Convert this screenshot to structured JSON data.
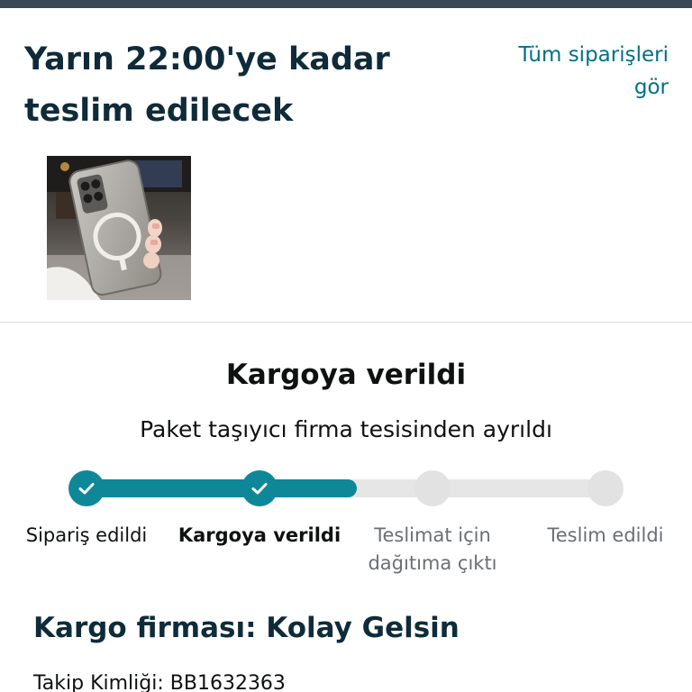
{
  "delivery": {
    "title_line1": "Yarın 22:00'ye kadar",
    "title_line2": "teslim edilecek",
    "all_orders_line1": "Tüm siparişleri",
    "all_orders_line2": "gör"
  },
  "product": {
    "image_icon": "phone-case-photo"
  },
  "shipment": {
    "status_title": "Kargoya verildi",
    "status_subtitle": "Paket taşıyıcı firma tesisinden ayrıldı",
    "progress_fraction": 0.52,
    "steps": [
      {
        "label_line1": "Sipariş edildi",
        "label_line2": "",
        "state": "done"
      },
      {
        "label_line1": "Kargoya verildi",
        "label_line2": "",
        "state": "current"
      },
      {
        "label_line1": "Teslimat için",
        "label_line2": "dağıtıma çıktı",
        "state": "todo"
      },
      {
        "label_line1": "Teslim edildi",
        "label_line2": "",
        "state": "todo"
      }
    ],
    "carrier_label": "Kargo firması: Kolay Gelsin",
    "tracking_label": "Takip Kimliği: BB1632363"
  },
  "colors": {
    "accent": "#0e8898",
    "link": "#007185",
    "heading": "#0f2b3a",
    "track": "#e6e6e6"
  }
}
